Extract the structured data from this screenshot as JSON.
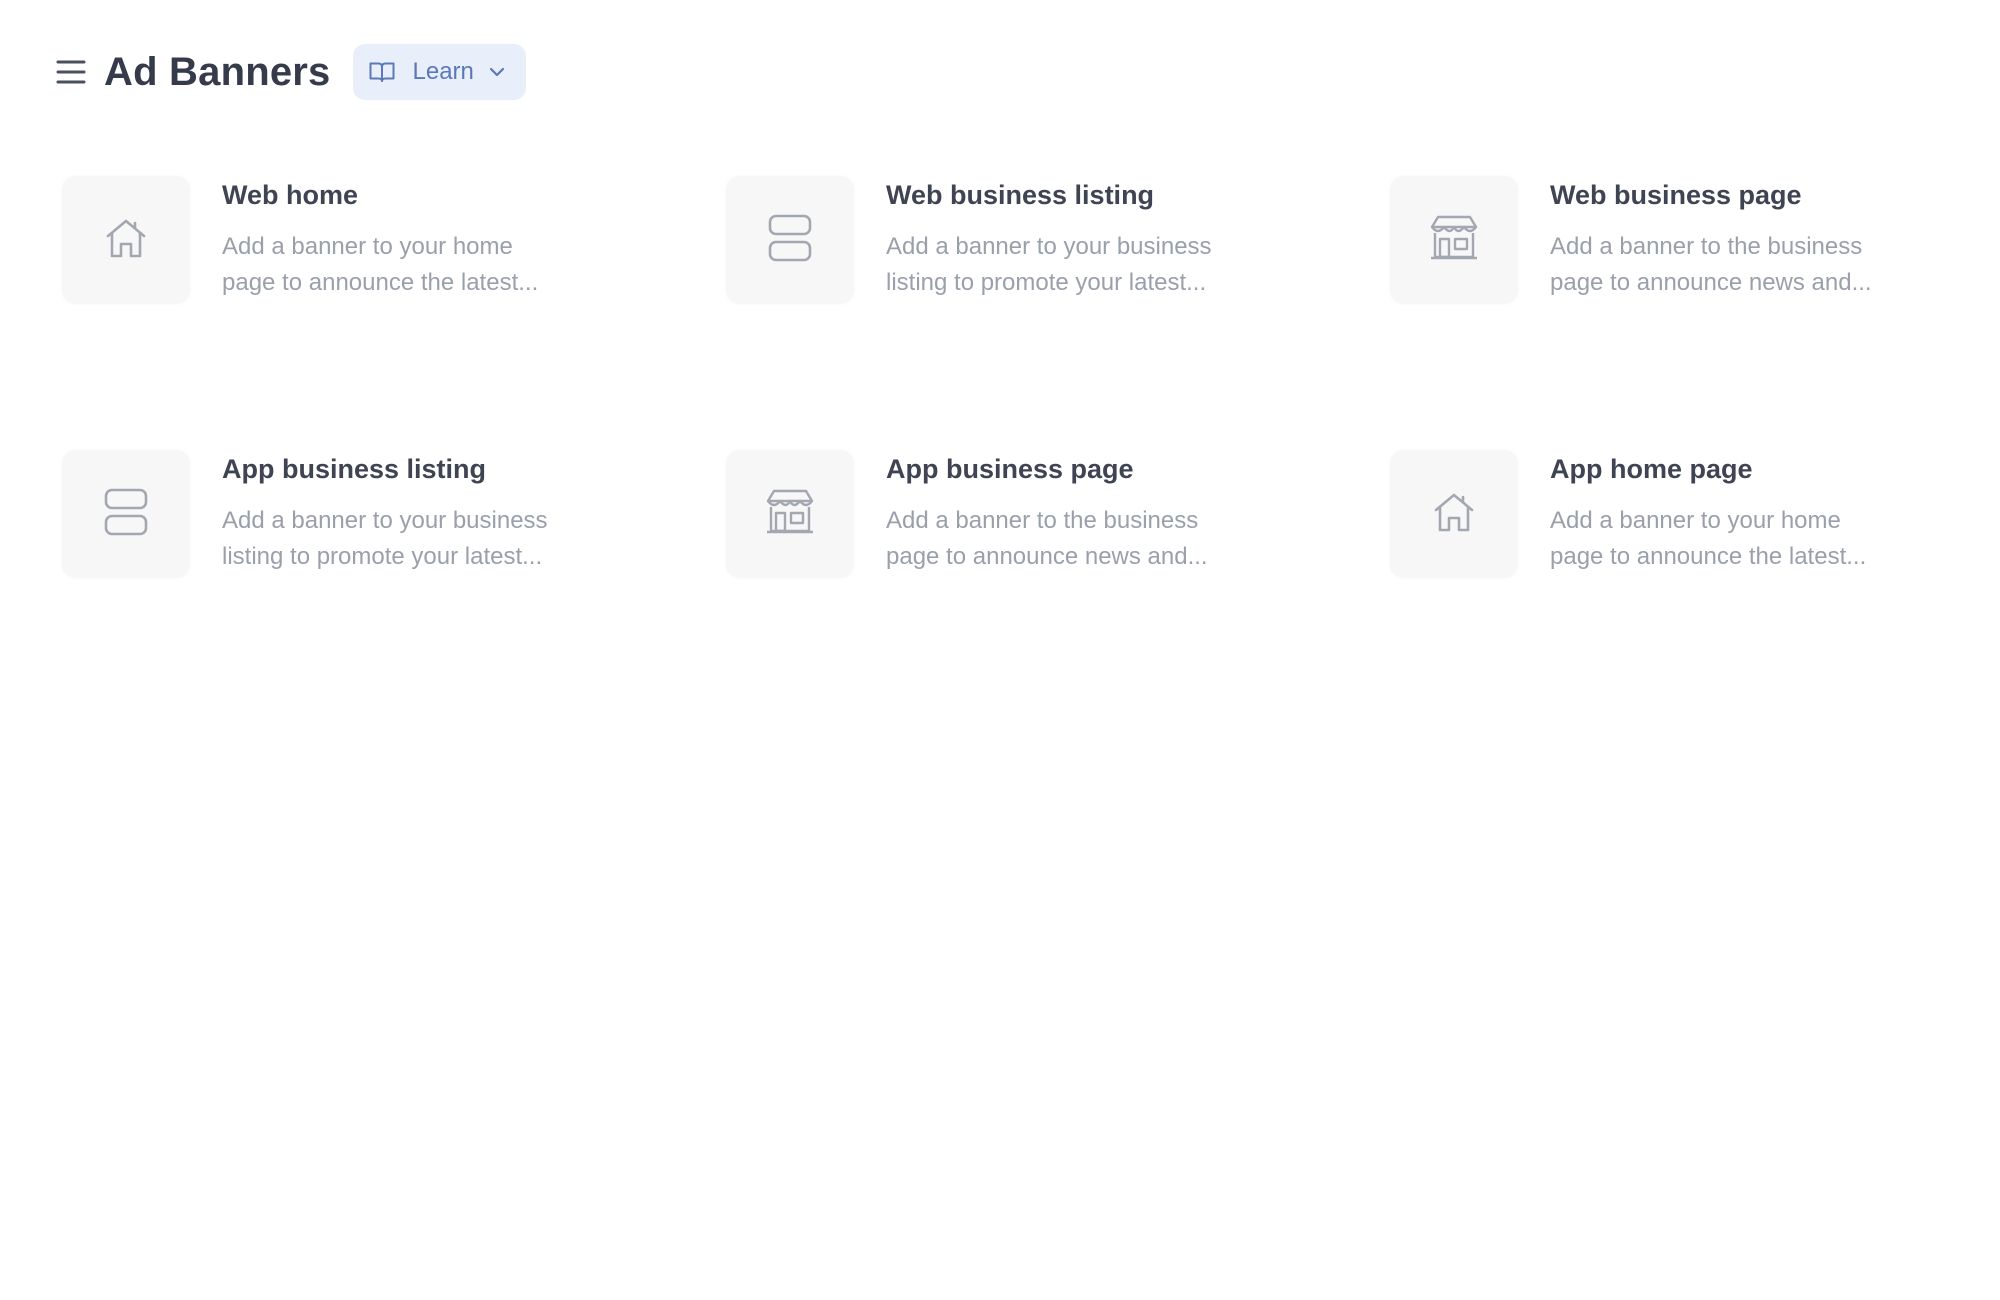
{
  "header": {
    "title": "Ad Banners",
    "learn_label": "Learn",
    "menu_icon": "hamburger-menu-icon",
    "learn_icon": "book-open-icon",
    "dropdown_icon": "chevron-down-icon"
  },
  "colors": {
    "title": "#353b4a",
    "learn_bg": "#e8effb",
    "learn_text": "#5b78b8",
    "icon_gray": "#a3a7b0",
    "desc_gray": "#9aa0ab"
  },
  "cards": [
    {
      "icon": "home-icon",
      "title": "Web home",
      "desc_line1": "Add a banner to your home",
      "desc_line2": "page to announce the latest..."
    },
    {
      "icon": "listing-rows-icon",
      "title": "Web business listing",
      "desc_line1": "Add a banner to your business",
      "desc_line2": "listing to promote your latest..."
    },
    {
      "icon": "storefront-icon",
      "title": "Web business page",
      "desc_line1": "Add a banner to the business",
      "desc_line2": "page to announce news and..."
    },
    {
      "icon": "listing-rows-icon",
      "title": "App business listing",
      "desc_line1": "Add a banner to your business",
      "desc_line2": "listing to promote your latest..."
    },
    {
      "icon": "storefront-icon",
      "title": "App business page",
      "desc_line1": "Add a banner to the business",
      "desc_line2": "page to announce news and..."
    },
    {
      "icon": "home-icon",
      "title": "App home page",
      "desc_line1": "Add a banner to your home",
      "desc_line2": "page to announce the latest..."
    }
  ]
}
